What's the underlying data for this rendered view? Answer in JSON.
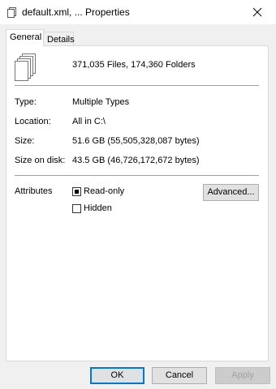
{
  "window": {
    "title": "default.xml, ... Properties",
    "title_icon": "document-icon",
    "close_icon": "close-icon"
  },
  "tabs": [
    {
      "label": "General",
      "active": true
    },
    {
      "label": "Details",
      "active": false
    }
  ],
  "general": {
    "summary": "371,035 Files, 174,360 Folders",
    "type_label": "Type:",
    "type_value": "Multiple Types",
    "location_label": "Location:",
    "location_value": "All in C:\\",
    "size_label": "Size:",
    "size_value": "51.6 GB (55,505,328,087 bytes)",
    "size_on_disk_label": "Size on disk:",
    "size_on_disk_value": "43.5 GB (46,726,172,672 bytes)",
    "attributes_label": "Attributes",
    "readonly_label": "Read-only",
    "readonly_state": "indeterminate",
    "hidden_label": "Hidden",
    "hidden_state": "unchecked",
    "advanced_label": "Advanced..."
  },
  "buttons": {
    "ok": "OK",
    "cancel": "Cancel",
    "apply": "Apply"
  },
  "colors": {
    "ok_border": "#0078d7",
    "disabled_text": "#a0a0a0"
  }
}
